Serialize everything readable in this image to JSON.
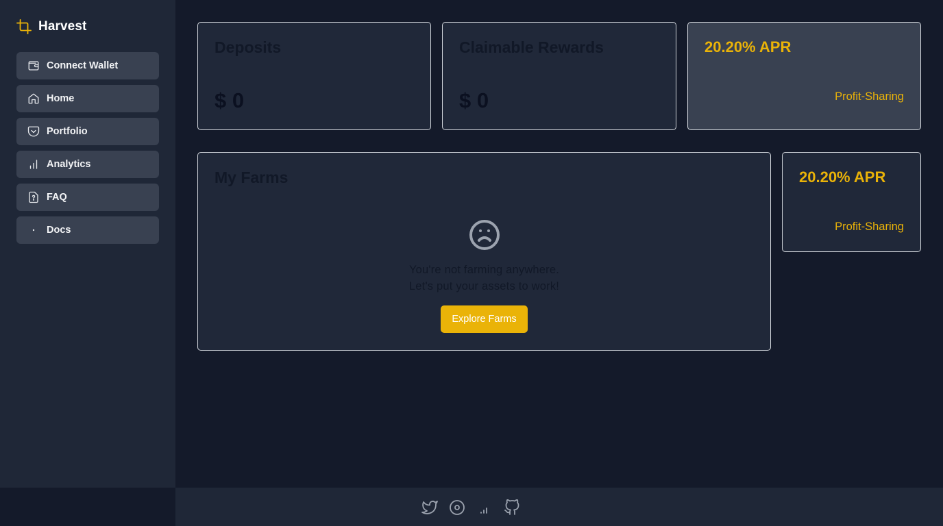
{
  "brand": {
    "name": "Harvest",
    "icon": "crop-icon",
    "accent": "#eab308"
  },
  "sidebar": {
    "items": [
      {
        "label": "Connect Wallet",
        "icon": "wallet-icon"
      },
      {
        "label": "Home",
        "icon": "home-icon"
      },
      {
        "label": "Portfolio",
        "icon": "pocket-icon"
      },
      {
        "label": "Analytics",
        "icon": "bar-chart-icon"
      },
      {
        "label": "FAQ",
        "icon": "file-question-icon"
      },
      {
        "label": "Docs",
        "icon": "dot-icon"
      }
    ]
  },
  "stats": {
    "deposits": {
      "title": "Deposits",
      "value": "$ 0"
    },
    "rewards": {
      "title": "Claimable Rewards",
      "value": "$ 0"
    },
    "apr_top": {
      "title": "20.20% APR",
      "subtitle": "Profit-Sharing"
    }
  },
  "farms": {
    "title": "My Farms",
    "empty_icon": "frown-icon",
    "empty_line1": "You're not farming anywhere.",
    "empty_line2": "Let's put your assets to work!",
    "button_label": "Explore Farms"
  },
  "apr_side": {
    "title": "20.20% APR",
    "subtitle": "Profit-Sharing"
  },
  "footer": {
    "links": [
      "twitter-icon",
      "disc-icon",
      "signal-icon",
      "github-icon"
    ]
  },
  "colors": {
    "background": "#141a2a",
    "sidebar": "#1f2737",
    "nav_item": "#394151",
    "card": "#202839",
    "card_highlight": "#394151",
    "accent": "#eab308"
  }
}
